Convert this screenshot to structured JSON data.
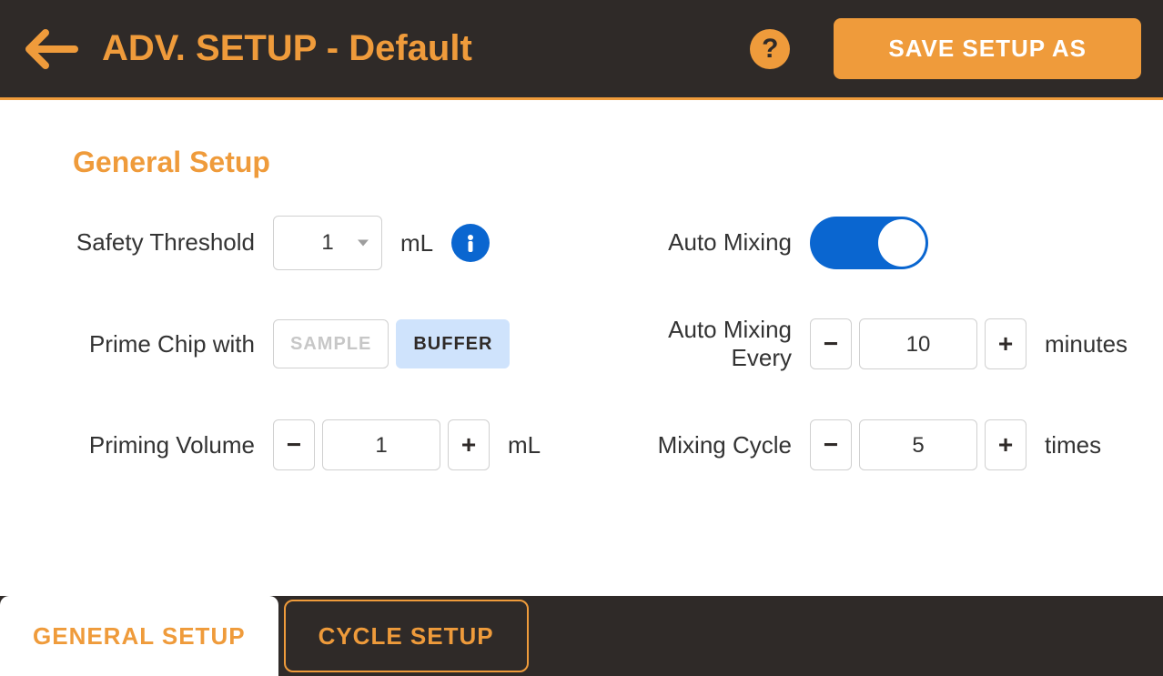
{
  "header": {
    "title": "ADV. SETUP - Default",
    "save_label": "SAVE SETUP AS",
    "help_symbol": "?"
  },
  "section": {
    "title": "General Setup"
  },
  "left": {
    "safety_threshold_label": "Safety Threshold",
    "safety_threshold_value": "1",
    "safety_threshold_unit": "mL",
    "prime_label": "Prime Chip with",
    "prime_option_sample": "SAMPLE",
    "prime_option_buffer": "BUFFER",
    "priming_volume_label": "Priming Volume",
    "priming_volume_value": "1",
    "priming_volume_unit": "mL"
  },
  "right": {
    "auto_mixing_label": "Auto Mixing",
    "auto_mixing_on": true,
    "auto_mixing_every_label": "Auto Mixing Every",
    "auto_mixing_every_value": "10",
    "auto_mixing_every_unit": "minutes",
    "mixing_cycle_label": "Mixing Cycle",
    "mixing_cycle_value": "5",
    "mixing_cycle_unit": "times"
  },
  "tabs": {
    "general": "GENERAL SETUP",
    "cycle": "CYCLE SETUP"
  },
  "glyph": {
    "minus": "−",
    "plus": "+"
  }
}
